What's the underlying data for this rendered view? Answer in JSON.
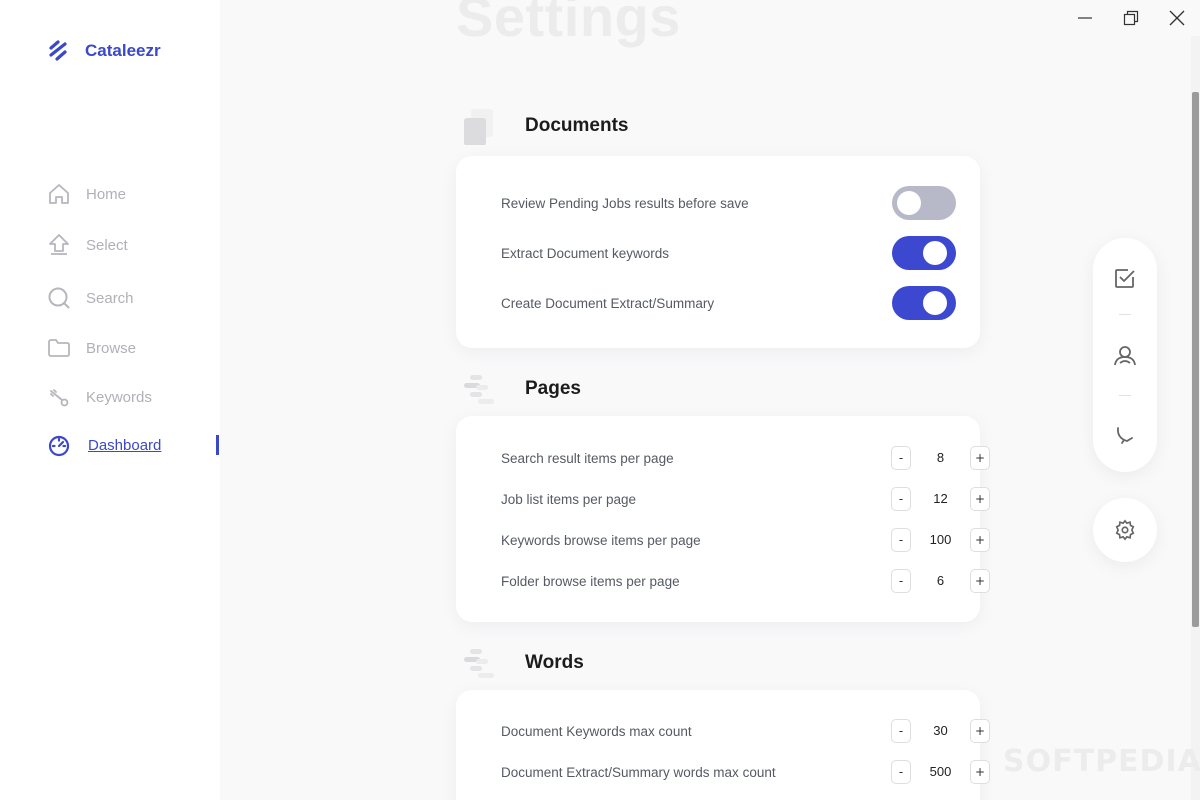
{
  "app": {
    "name": "Cataleezr"
  },
  "sidebar": {
    "items": [
      {
        "label": "Home",
        "icon": "home-icon"
      },
      {
        "label": "Select",
        "icon": "upload-icon"
      },
      {
        "label": "Search",
        "icon": "search-icon"
      },
      {
        "label": "Browse",
        "icon": "folder-icon"
      },
      {
        "label": "Keywords",
        "icon": "key-icon"
      },
      {
        "label": "Dashboard",
        "icon": "dashboard-icon",
        "active": true
      }
    ]
  },
  "page": {
    "title": "Settings"
  },
  "sections": {
    "documents": {
      "title": "Documents",
      "toggles": [
        {
          "label": "Review Pending Jobs results before save",
          "on": false
        },
        {
          "label": "Extract Document keywords",
          "on": true
        },
        {
          "label": "Create Document Extract/Summary",
          "on": true
        }
      ]
    },
    "pages": {
      "title": "Pages",
      "steppers": [
        {
          "label": "Search result items per page",
          "value": "8"
        },
        {
          "label": "Job list items per page",
          "value": "12"
        },
        {
          "label": "Keywords browse items per page",
          "value": "100"
        },
        {
          "label": "Folder browse items per page",
          "value": "6"
        }
      ]
    },
    "words": {
      "title": "Words",
      "steppers": [
        {
          "label": "Document Keywords max count",
          "value": "30"
        },
        {
          "label": "Document Extract/Summary words max count",
          "value": "500"
        }
      ]
    }
  },
  "stepper_buttons": {
    "minus": "-",
    "plus": "+"
  },
  "right_panel": {
    "icons": [
      "checklist-icon",
      "user-icon",
      "phone-icon",
      "gear-icon"
    ]
  },
  "watermark": "SOFTPEDIA",
  "colors": {
    "accent": "#3b48cf",
    "toggle_off": "#b8b9c8",
    "muted_text": "#b0b0b8"
  }
}
